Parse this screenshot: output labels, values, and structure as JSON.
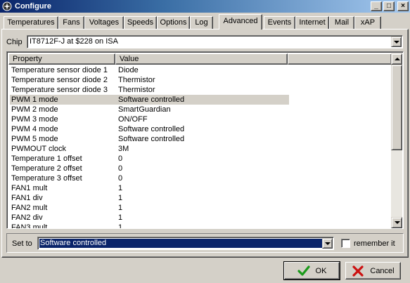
{
  "window": {
    "title": "Configure",
    "minimize_glyph": "_",
    "maximize_glyph": "□",
    "close_glyph": "×"
  },
  "tabs": [
    {
      "label": "Temperatures"
    },
    {
      "label": "Fans"
    },
    {
      "label": "Voltages"
    },
    {
      "label": "Speeds"
    },
    {
      "label": "Options"
    },
    {
      "label": "Log"
    },
    {
      "label": "Advanced",
      "active": true
    },
    {
      "label": "Events"
    },
    {
      "label": "Internet"
    },
    {
      "label": "Mail"
    },
    {
      "label": "xAP"
    }
  ],
  "chip": {
    "label": "Chip",
    "value": "IT8712F-J at $228 on ISA"
  },
  "list": {
    "columns": [
      "Property",
      "Value"
    ],
    "rows": [
      [
        "Temperature sensor diode 1",
        "Diode"
      ],
      [
        "Temperature sensor diode 2",
        "Thermistor"
      ],
      [
        "Temperature sensor diode 3",
        "Thermistor"
      ],
      [
        "PWM 1 mode",
        "Software controlled"
      ],
      [
        "PWM 2 mode",
        "SmartGuardian"
      ],
      [
        "PWM 3 mode",
        "ON/OFF"
      ],
      [
        "PWM 4 mode",
        "Software controlled"
      ],
      [
        "PWM 5 mode",
        "Software controlled"
      ],
      [
        "PWMOUT clock",
        "3M"
      ],
      [
        "Temperature 1 offset",
        "0"
      ],
      [
        "Temperature 2 offset",
        "0"
      ],
      [
        "Temperature 3 offset",
        "0"
      ],
      [
        "FAN1 mult",
        "1"
      ],
      [
        "FAN1 div",
        "1"
      ],
      [
        "FAN2 mult",
        "1"
      ],
      [
        "FAN2 div",
        "1"
      ],
      [
        "FAN3 mult",
        "1"
      ]
    ],
    "selected_index": 3
  },
  "set_to": {
    "label": "Set to",
    "value": "Software controlled"
  },
  "remember": {
    "label": "remember it",
    "checked": false
  },
  "buttons": {
    "ok_label": "OK",
    "cancel_label": "Cancel"
  },
  "colors": {
    "title_bar": "#0a246a",
    "face": "#d4d0c8",
    "selection": "#0a246a",
    "ok_check": "#1a9a1a",
    "cancel_x": "#cc1111"
  }
}
